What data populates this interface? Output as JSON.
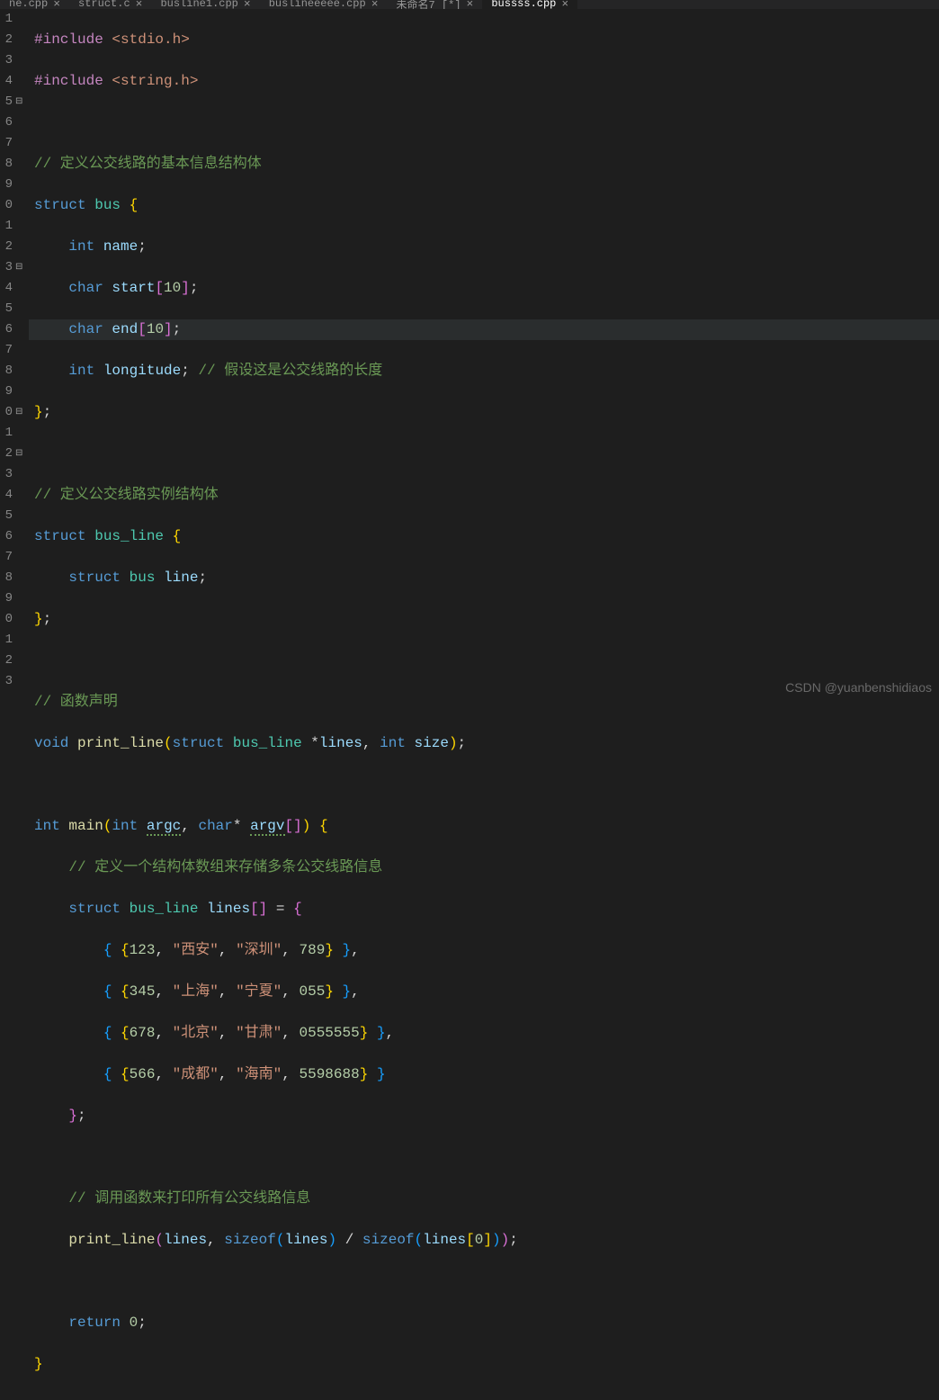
{
  "tabs": [
    {
      "name": "ne.cpp",
      "active": false
    },
    {
      "name": "struct.c",
      "active": false
    },
    {
      "name": "busline1.cpp",
      "active": false
    },
    {
      "name": "buslineeeee.cpp",
      "active": false
    },
    {
      "name": "未命名7 [*]",
      "active": false
    },
    {
      "name": "bussss.cpp",
      "active": true
    }
  ],
  "close_glyph": "×",
  "watermark": "CSDN @yuanbenshidiaos",
  "fold_glyph": "⊟",
  "line_numbers": [
    "1",
    "2",
    "3",
    "4",
    "5",
    "6",
    "7",
    "8",
    "9",
    "0",
    "1",
    "2",
    "3",
    "4",
    "5",
    "6",
    "7",
    "8",
    "9",
    "0",
    "1",
    "2",
    "3",
    "4",
    "5",
    "6",
    "7",
    "8",
    "9",
    "0",
    "1",
    "2",
    "3"
  ],
  "code": {
    "l1": {
      "include": "#include",
      "hdr": "<stdio.h>"
    },
    "l2": {
      "include": "#include",
      "hdr": "<string.h>"
    },
    "l4": {
      "cmt": "// 定义公交线路的基本信息结构体"
    },
    "l5": {
      "kw": "struct",
      "type": "bus",
      "br": "{"
    },
    "l6": {
      "kw": "int",
      "var": "name",
      "end": ";"
    },
    "l7": {
      "kw": "char",
      "var": "start",
      "idx": "10",
      "end": ";"
    },
    "l8": {
      "kw": "char",
      "var": "end",
      "idx": "10",
      "end": ";"
    },
    "l9": {
      "kw": "int",
      "var": "longitude",
      "end": ";",
      "cmt": "// 假设这是公交线路的长度"
    },
    "l10": {
      "br": "}",
      "end": ";"
    },
    "l12": {
      "cmt": "// 定义公交线路实例结构体"
    },
    "l13": {
      "kw": "struct",
      "type": "bus_line",
      "br": "{"
    },
    "l14": {
      "kw": "struct",
      "type": "bus",
      "var": "line",
      "end": ";"
    },
    "l15": {
      "br": "}",
      "end": ";"
    },
    "l17": {
      "cmt": "// 函数声明"
    },
    "l18": {
      "kw1": "void",
      "fn": "print_line",
      "kw2": "struct",
      "type": "bus_line",
      "star": "*",
      "p1": "lines",
      "kw3": "int",
      "p2": "size",
      "end": ";"
    },
    "l20": {
      "kw1": "int",
      "fn": "main",
      "kw2": "int",
      "p1": "argc",
      "kw3": "char",
      "star": "*",
      "p2": "argv",
      "br": "{"
    },
    "l21": {
      "cmt": "// 定义一个结构体数组来存储多条公交线路信息"
    },
    "l22": {
      "kw": "struct",
      "type": "bus_line",
      "var": "lines",
      "eq": " = ",
      "br": "{"
    },
    "l23": {
      "n1": "123",
      "s1": "\"西安\"",
      "s2": "\"深圳\"",
      "n2": "789"
    },
    "l24": {
      "n1": "345",
      "s1": "\"上海\"",
      "s2": "\"宁夏\"",
      "n2": "055"
    },
    "l25": {
      "n1": "678",
      "s1": "\"北京\"",
      "s2": "\"甘肃\"",
      "n2": "0555555"
    },
    "l26": {
      "n1": "566",
      "s1": "\"成都\"",
      "s2": "\"海南\"",
      "n2": "5598688"
    },
    "l27": {
      "br": "}",
      "end": ";"
    },
    "l29": {
      "cmt": "// 调用函数来打印所有公交线路信息"
    },
    "l30": {
      "fn": "print_line",
      "a1": "lines",
      "kw": "sizeof",
      "a2": "lines",
      "a3": "lines",
      "idx": "0",
      "end": ";"
    },
    "l32": {
      "kw": "return",
      "n": "0",
      "end": ";"
    },
    "l33": {
      "br": "}"
    }
  }
}
